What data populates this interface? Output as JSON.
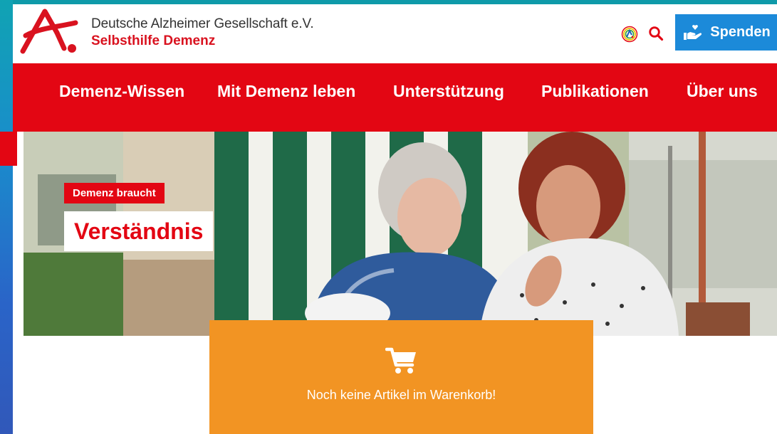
{
  "header": {
    "org_name": "Deutsche Alzheimer Gesellschaft e.V.",
    "org_subtitle": "Selbsthilfe Demenz",
    "icons": [
      "language-icon",
      "search-icon",
      "donate-hand-heart-icon"
    ],
    "donate_label": "Spenden"
  },
  "nav": {
    "items": [
      {
        "label": "Demenz-Wissen"
      },
      {
        "label": "Mit Demenz leben"
      },
      {
        "label": "Unterstützung"
      },
      {
        "label": "Publikationen"
      },
      {
        "label": "Über uns"
      }
    ]
  },
  "hero": {
    "kicker": "Demenz braucht",
    "title": "Verständnis"
  },
  "cart": {
    "icon": "shopping-cart-icon",
    "message": "Noch keine Artikel im Warenkorb!"
  },
  "colors": {
    "brand_red": "#e30613",
    "donate_blue": "#1c8ad9",
    "cart_orange": "#f29423",
    "edge_teal": "#0f9aa9"
  }
}
